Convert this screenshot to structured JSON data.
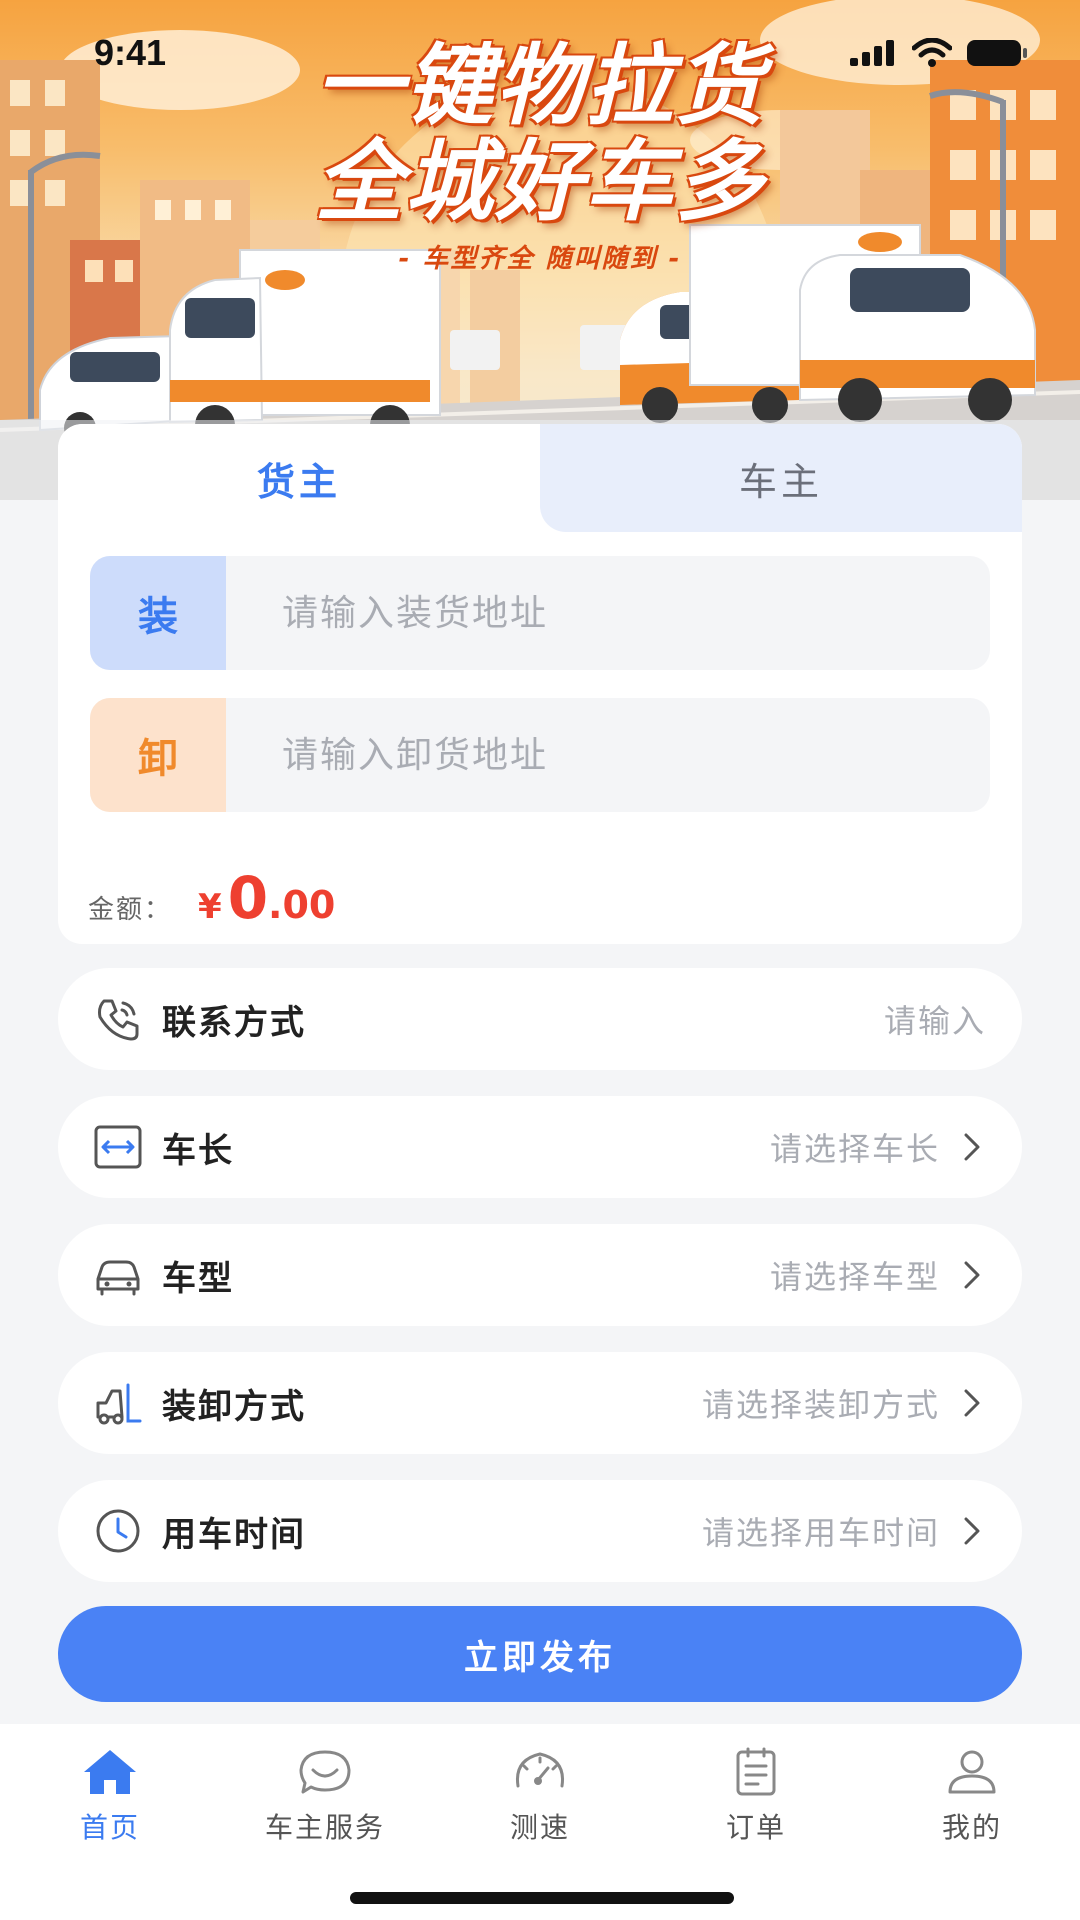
{
  "status_bar": {
    "time": "9:41"
  },
  "banner": {
    "headline_line1": "一键物拉货",
    "headline_line2": "全城好车多",
    "slogan": "- 车型齐全 随叫随到 -"
  },
  "tabs": [
    {
      "label": "货主",
      "active": true
    },
    {
      "label": "车主",
      "active": false
    }
  ],
  "address": {
    "load_tag": "装",
    "load_placeholder": "请输入装货地址",
    "unload_tag": "卸",
    "unload_placeholder": "请输入卸货地址"
  },
  "amount": {
    "label": "金额：",
    "currency": "¥",
    "integer": "0",
    "decimal": ".00"
  },
  "fields": {
    "contact": {
      "label": "联系方式",
      "value": "请输入",
      "icon": "phone-icon"
    },
    "length": {
      "label": "车长",
      "value": "请选择车长",
      "icon": "length-icon"
    },
    "type": {
      "label": "车型",
      "value": "请选择车型",
      "icon": "car-icon"
    },
    "loading": {
      "label": "装卸方式",
      "value": "请选择装卸方式",
      "icon": "forklift-icon"
    },
    "time": {
      "label": "用车时间",
      "value": "请选择用车时间",
      "icon": "clock-icon"
    }
  },
  "submit_label": "立即发布",
  "nav": [
    {
      "label": "首页",
      "icon": "home-icon",
      "active": true
    },
    {
      "label": "车主服务",
      "icon": "chat-icon",
      "active": false
    },
    {
      "label": "测速",
      "icon": "speedometer-icon",
      "active": false
    },
    {
      "label": "订单",
      "icon": "order-icon",
      "active": false
    },
    {
      "label": "我的",
      "icon": "user-icon",
      "active": false
    }
  ],
  "colors": {
    "primary": "#4a82f5",
    "active_tab": "#3b7bf0",
    "amount": "#ee4030",
    "unload_tag": "#f08a2c"
  }
}
